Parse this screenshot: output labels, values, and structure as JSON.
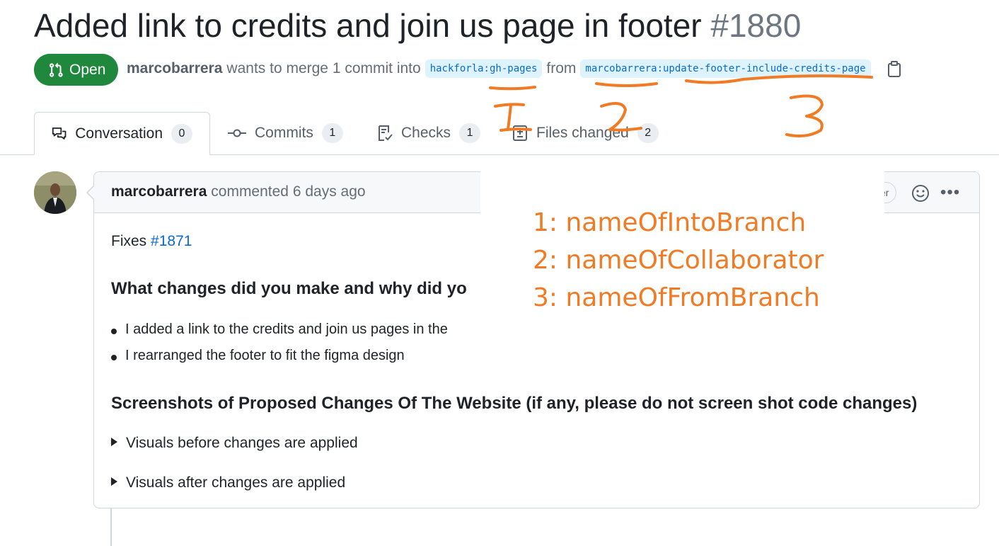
{
  "pr": {
    "title": "Added link to credits and join us page in footer",
    "number": "#1880",
    "state": "Open",
    "author": "marcobarrera",
    "merge_text": "wants to merge 1 commit into",
    "base_branch": "hackforla:gh-pages",
    "from_text": "from",
    "head_branch": "marcobarrera:update-footer-include-credits-page"
  },
  "tabs": [
    {
      "label": "Conversation",
      "count": "0",
      "icon": "comment-discussion-icon",
      "active": true
    },
    {
      "label": "Commits",
      "count": "1",
      "icon": "git-commit-icon"
    },
    {
      "label": "Checks",
      "count": "1",
      "icon": "checklist-icon"
    },
    {
      "label": "Files changed",
      "count": "2",
      "icon": "file-diff-icon"
    }
  ],
  "comment": {
    "author": "marcobarrera",
    "action": "commented 6 days ago",
    "role_badge_partial": "er",
    "fixes_label": "Fixes",
    "fixes_issue": "#1871",
    "heading1": "What changes did you make and why did yo",
    "bullets": [
      "I added a link to the credits and join us pages in the",
      "I rearranged the footer to fit the figma design"
    ],
    "heading2": "Screenshots of Proposed Changes Of The Website (if any, please do not screen shot code changes)",
    "details": [
      "Visuals before changes are applied",
      "Visuals after changes are applied"
    ]
  },
  "annotations": {
    "color": "#f07b24",
    "marks": [
      "1",
      "2",
      "3"
    ],
    "legend": [
      "1: nameOfIntoBranch",
      "2: nameOfCollaborator",
      "3: nameOfFromBranch"
    ]
  },
  "colors": {
    "open_green": "#1f883d",
    "link_blue": "#0969da",
    "branch_bg": "#ddf4ff",
    "annotation_orange": "#f07b24"
  }
}
